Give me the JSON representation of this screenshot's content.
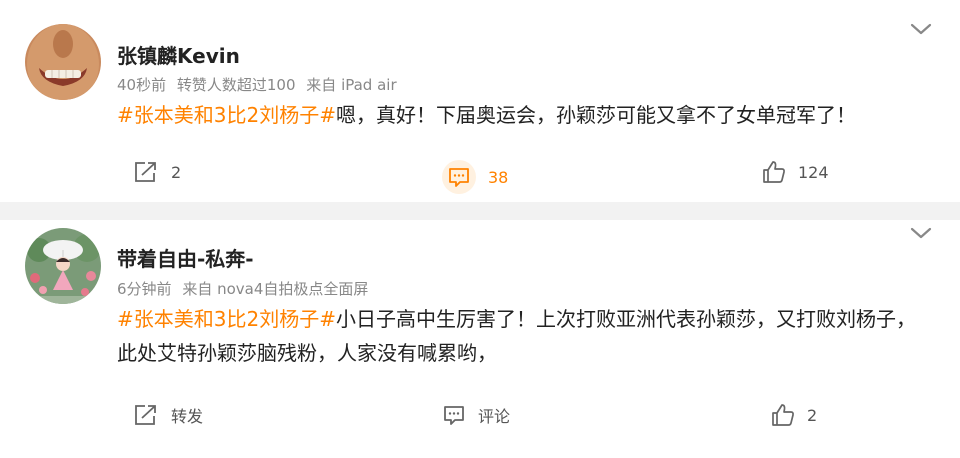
{
  "posts": [
    {
      "username": "张镇麟Kevin",
      "time": "40秒前",
      "reposts_note": "转赞人数超过100",
      "source": "来自 iPad air",
      "hashtag": "#张本美和3比2刘杨子#",
      "text": "嗯，真好！下届奥运会，孙颖莎可能又拿不了女单冠军了！",
      "repost_label": "2",
      "comment_label": "38",
      "like_label": "124"
    },
    {
      "username": "带着自由-私奔-",
      "time": "6分钟前",
      "source": "来自 nova4自拍极点全面屏",
      "hashtag": "#张本美和3比2刘杨子#",
      "text": "小日子高中生厉害了！上次打败亚洲代表孙颖莎，又打败刘杨子，此处艾特孙颖莎脑残粉，人家没有喊累哟，",
      "repost_label": "转发",
      "comment_label": "评论",
      "like_label": "2"
    }
  ],
  "colors": {
    "accent": "#ff8200",
    "meta": "#888888",
    "divider": "#f2f2f2"
  },
  "icons": [
    "chevron-down-icon",
    "repost-icon",
    "comment-icon",
    "like-icon"
  ]
}
